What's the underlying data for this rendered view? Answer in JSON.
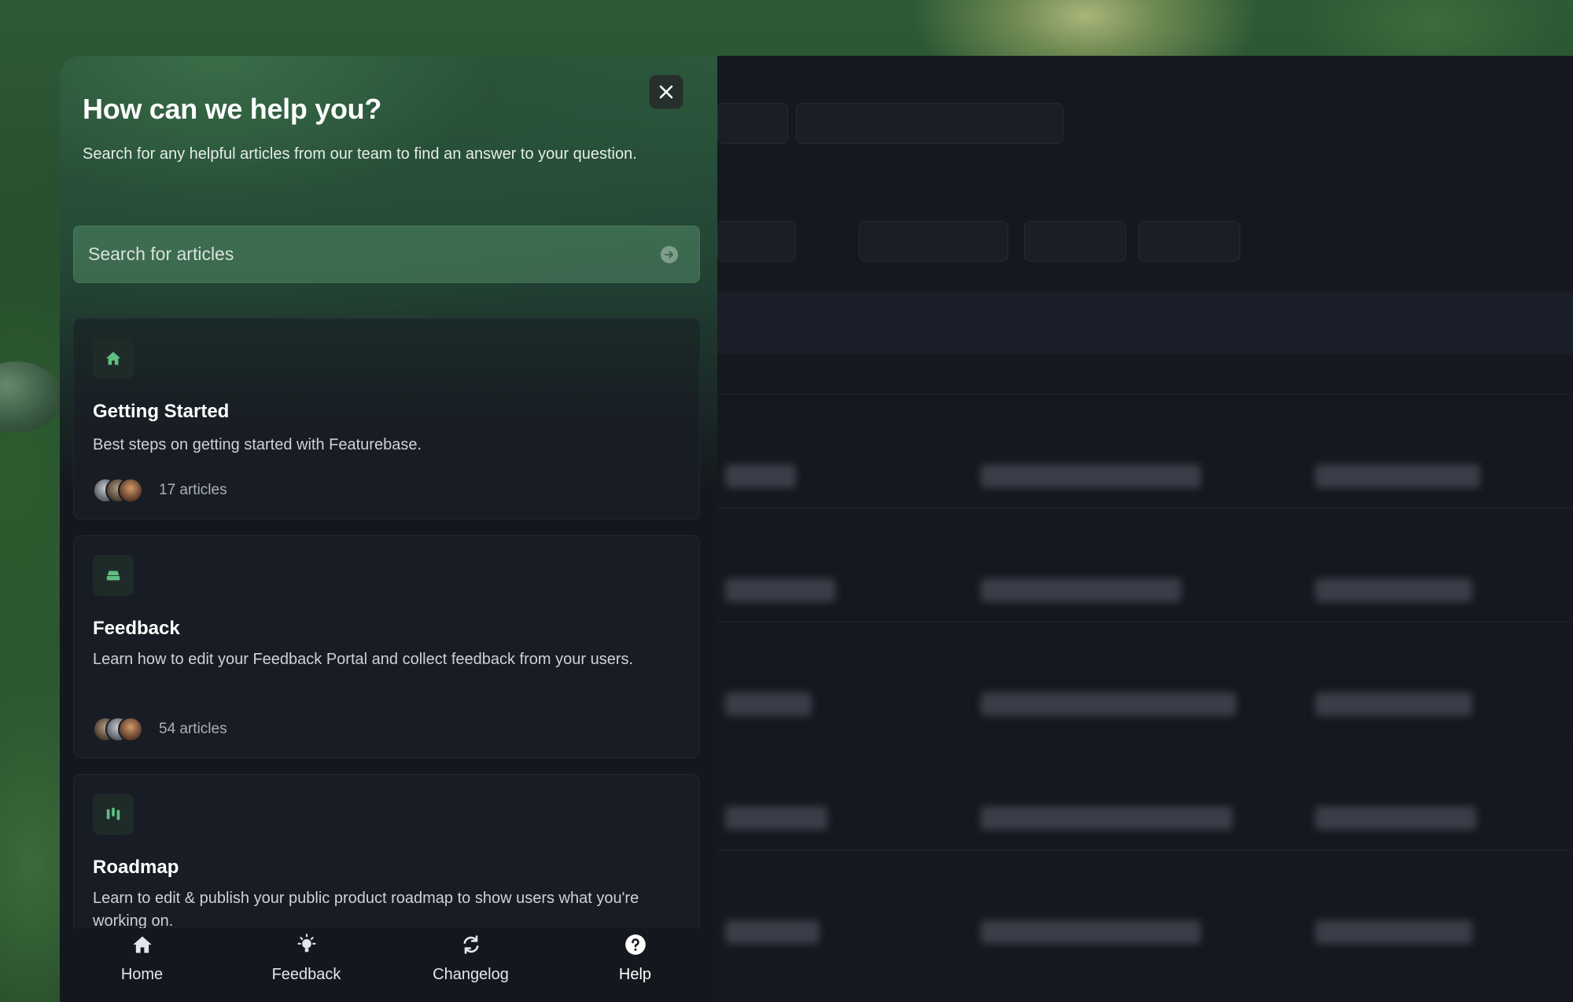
{
  "panel": {
    "title": "How can we help you?",
    "subtitle": "Search for any helpful articles from our team to find an answer to your question.",
    "search": {
      "placeholder": "Search for articles"
    },
    "close_icon": "close-icon"
  },
  "collections": [
    {
      "icon": "home-icon",
      "title": "Getting Started",
      "description": "Best steps on getting started with Featurebase.",
      "count": "17 articles"
    },
    {
      "icon": "inbox-icon",
      "title": "Feedback",
      "description": "Learn how to edit your Feedback Portal and collect feedback from your users.",
      "count": "54 articles"
    },
    {
      "icon": "roadmap-icon",
      "title": "Roadmap",
      "description": "Learn to edit & publish your public product roadmap to show users what you're working on."
    }
  ],
  "nav": [
    {
      "label": "Home",
      "icon": "home-icon"
    },
    {
      "label": "Feedback",
      "icon": "lightbulb-icon"
    },
    {
      "label": "Changelog",
      "icon": "refresh-icon"
    },
    {
      "label": "Help",
      "icon": "help-icon",
      "active": true
    }
  ],
  "colors": {
    "accent": "#4f9c6a",
    "panel_bg": "#14171d",
    "card_bg": "#181c24"
  }
}
